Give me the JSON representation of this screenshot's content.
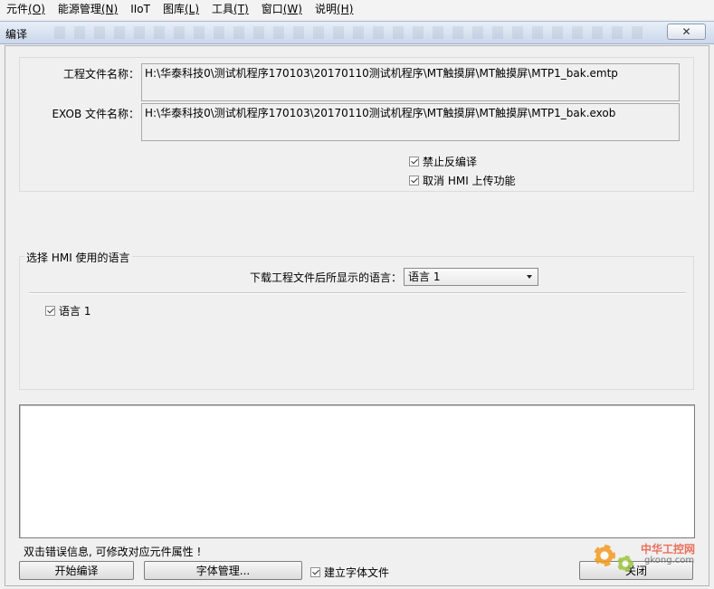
{
  "menu": [
    {
      "label": "元件",
      "key": "(O)"
    },
    {
      "label": "能源管理",
      "key": "(N)"
    },
    {
      "label": "IIoT",
      "key": ""
    },
    {
      "label": "图库",
      "key": "(L)"
    },
    {
      "label": "工具",
      "key": "(T)"
    },
    {
      "label": "窗口",
      "key": "(W)"
    },
    {
      "label": "说明",
      "key": "(H)"
    }
  ],
  "window": {
    "title": "编译",
    "close_glyph": "✕"
  },
  "files": {
    "project_label": "工程文件名称：",
    "project_path": "H:\\华泰科技0\\测试机程序170103\\20170110测试机程序\\MT触摸屏\\MT触摸屏\\MTP1_bak.emtp",
    "exob_label": "EXOB 文件名称：",
    "exob_path": "H:\\华泰科技0\\测试机程序170103\\20170110测试机程序\\MT触摸屏\\MT触摸屏\\MTP1_bak.exob"
  },
  "options": {
    "disable_decompile": {
      "label": "禁止反编译",
      "checked": true
    },
    "cancel_upload": {
      "label": "取消 HMI 上传功能",
      "checked": true
    }
  },
  "language_group": {
    "title": "选择 HMI 使用的语言",
    "download_label": "下载工程文件后所显示的语言：",
    "selected_language": "语言 1",
    "languages": [
      {
        "label": "语言 1",
        "checked": true
      }
    ]
  },
  "footer": {
    "hint": "双击错误信息, 可修改对应元件属性 !",
    "start_compile": "开始编译",
    "font_manage": "字体管理...",
    "build_font_file": {
      "label": "建立字体文件",
      "checked": true
    },
    "close": "关闭"
  },
  "watermark": {
    "line1": "中华工控网",
    "line2": "gkong.com"
  }
}
